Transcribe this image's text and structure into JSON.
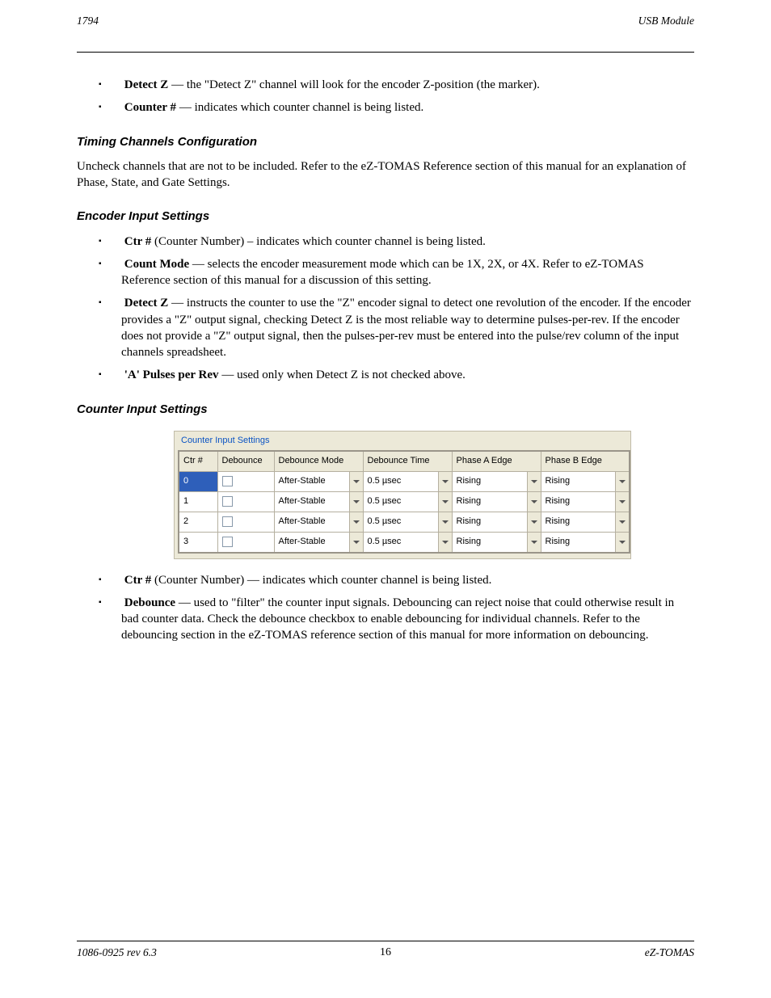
{
  "header": {
    "left": "1794",
    "right": "USB Module"
  },
  "s1": {
    "b1": {
      "label": "Detect Z",
      "text": " — the \"Detect Z\" channel will look for the encoder Z-position (the marker)."
    },
    "b2": {
      "label": "Counter #",
      "text": " — indicates which counter channel is being listed."
    }
  },
  "heading_timing": "Timing Channels Configuration",
  "p_timing": "Uncheck channels that are not to be included. Refer to the eZ-TOMAS Reference section of this manual for an explanation of Phase, State, and Gate Settings.",
  "heading_enc": "Encoder Input Settings",
  "s2": {
    "b1": {
      "label": "Ctr #",
      "text": " (Counter Number) – indicates which counter channel is being listed."
    },
    "b2": {
      "label": "Count Mode",
      "text": " — selects the encoder measurement mode which can be 1X, 2X, or 4X. Refer to eZ-TOMAS Reference section of this manual for a discussion of this setting."
    },
    "b3": {
      "label": "Detect Z",
      "text": " — instructs the counter to use the \"Z\" encoder signal to detect one revolution of the encoder. If the encoder provides a \"Z\" output signal, checking Detect Z is the most reliable way to determine pulses-per-rev. If the encoder does not provide a \"Z\" output signal, then the pulses-per-rev must be entered into the pulse/rev column of the input channels spreadsheet."
    },
    "b4": {
      "label": "'A' Pulses per Rev",
      "text": " — used only when Detect Z is not checked above."
    }
  },
  "heading_cis": "Counter Input Settings",
  "panel": {
    "title": "Counter Input Settings",
    "columns": [
      "Ctr #",
      "Debounce",
      "Debounce Mode",
      "Debounce Time",
      "Phase A Edge",
      "Phase B Edge"
    ],
    "rows": [
      {
        "ctr": "0",
        "mode": "After-Stable",
        "time": "0.5 µsec",
        "a": "Rising",
        "b": "Rising"
      },
      {
        "ctr": "1",
        "mode": "After-Stable",
        "time": "0.5 µsec",
        "a": "Rising",
        "b": "Rising"
      },
      {
        "ctr": "2",
        "mode": "After-Stable",
        "time": "0.5 µsec",
        "a": "Rising",
        "b": "Rising"
      },
      {
        "ctr": "3",
        "mode": "After-Stable",
        "time": "0.5 µsec",
        "a": "Rising",
        "b": "Rising"
      }
    ]
  },
  "s3": {
    "b1": {
      "label": "Ctr #",
      "text": " (Counter Number) — indicates which counter channel is being listed."
    },
    "b2": {
      "label": "Debounce",
      "text": " — used to \"filter\" the counter input signals. Debouncing can reject noise that could otherwise result in bad counter data. Check the debounce checkbox to enable debouncing for individual channels. Refer to the debouncing section in the eZ-TOMAS reference section of this manual for more information on debouncing."
    }
  },
  "footer": {
    "left": "1086-0925 rev 6.3",
    "center": "16",
    "right": "eZ-TOMAS"
  }
}
